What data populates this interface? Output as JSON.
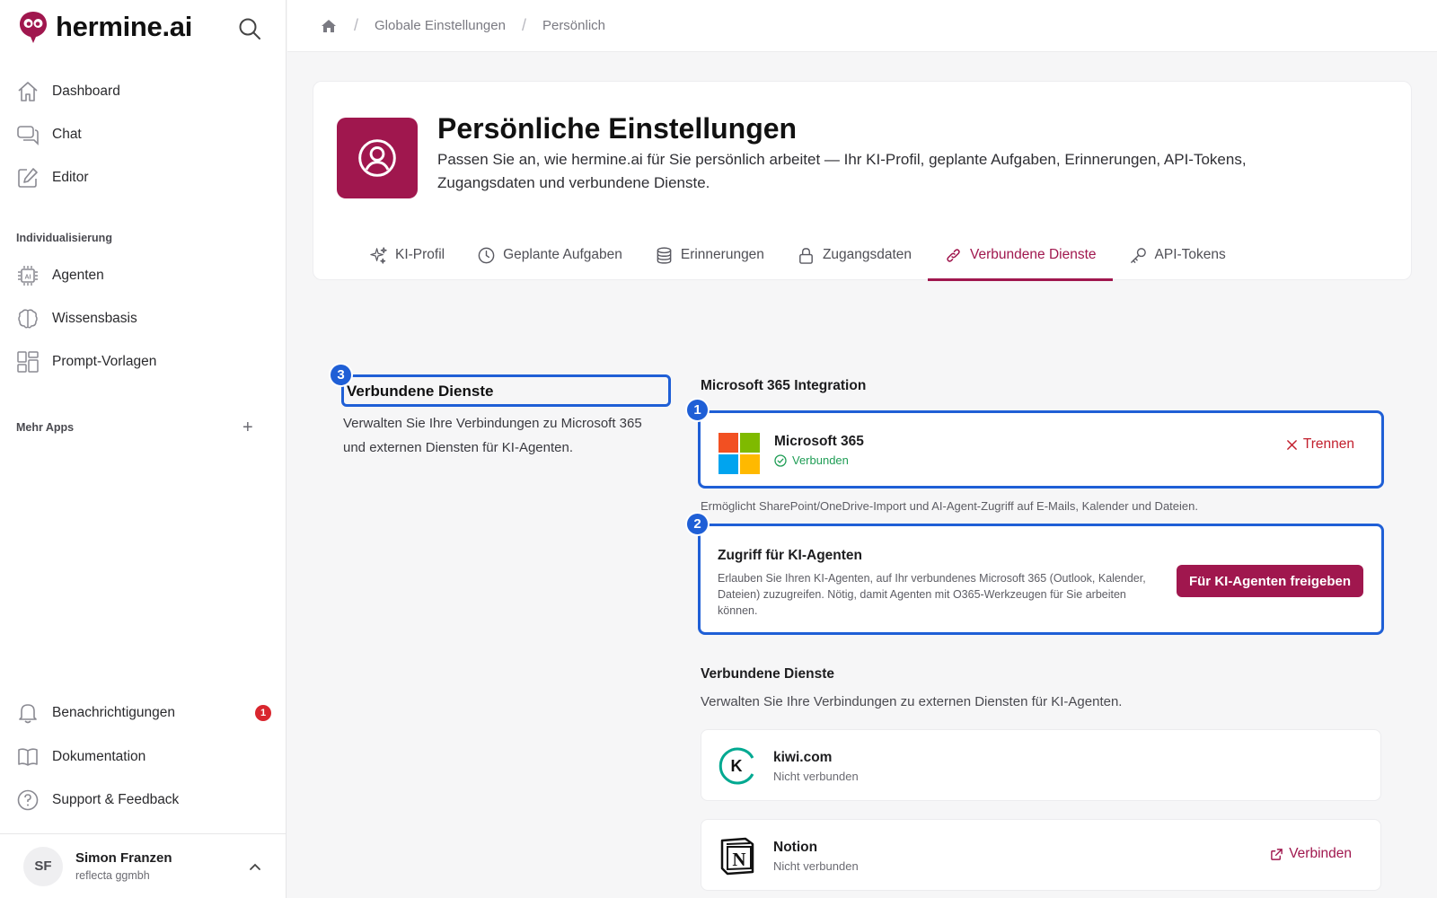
{
  "brand": {
    "name": "hermine.ai",
    "accent": "#a0174e",
    "highlight": "#1f5fd6"
  },
  "sidebar": {
    "primary": [
      {
        "label": "Dashboard",
        "icon": "home-icon"
      },
      {
        "label": "Chat",
        "icon": "chat-icon"
      },
      {
        "label": "Editor",
        "icon": "edit-icon"
      }
    ],
    "section_custom": "Individualisierung",
    "custom": [
      {
        "label": "Agenten",
        "icon": "ai-chip-icon"
      },
      {
        "label": "Wissensbasis",
        "icon": "brain-icon"
      },
      {
        "label": "Prompt-Vorlagen",
        "icon": "template-icon"
      }
    ],
    "section_apps": "Mehr Apps",
    "plus": "+",
    "bottom": [
      {
        "label": "Benachrichtigungen",
        "icon": "bell-icon",
        "badge": "1"
      },
      {
        "label": "Dokumentation",
        "icon": "book-icon"
      },
      {
        "label": "Support & Feedback",
        "icon": "help-icon"
      }
    ],
    "user": {
      "initials": "SF",
      "name": "Simon Franzen",
      "org": "reflecta ggmbh"
    }
  },
  "breadcrumb": [
    "Globale Einstellungen",
    "Persönlich"
  ],
  "header": {
    "title": "Persönliche Einstellungen",
    "subtitle": "Passen Sie an, wie hermine.ai für Sie persönlich arbeitet — Ihr KI-Profil, geplante Aufgaben, Erinnerungen, API-Tokens, Zugangsdaten und verbundene Dienste."
  },
  "tabs": [
    {
      "label": "KI-Profil",
      "icon": "sparkles-icon",
      "active": false
    },
    {
      "label": "Geplante Aufgaben",
      "icon": "clock-icon",
      "active": false
    },
    {
      "label": "Erinnerungen",
      "icon": "database-icon",
      "active": false
    },
    {
      "label": "Zugangsdaten",
      "icon": "lock-icon",
      "active": false
    },
    {
      "label": "Verbundene Dienste",
      "icon": "link-icon",
      "active": true
    },
    {
      "label": "API-Tokens",
      "icon": "key-icon",
      "active": false
    }
  ],
  "section": {
    "badge": "3",
    "title": "Verbundene Dienste",
    "description": "Verwalten Sie Ihre Verbindungen zu Microsoft 365 und externen Diensten für KI-Agenten."
  },
  "microsoft": {
    "heading": "Microsoft 365 Integration",
    "badge": "1",
    "name": "Microsoft 365",
    "status": "Verbunden",
    "disconnect": "Trennen",
    "note": "Ermöglicht SharePoint/OneDrive-Import und AI-Agent-Zugriff auf E-Mails, Kalender und Dateien."
  },
  "agent_access": {
    "badge": "2",
    "title": "Zugriff für KI-Agenten",
    "description": "Erlauben Sie Ihren KI-Agenten, auf Ihr verbundenes Microsoft 365 (Outlook, Kalender, Dateien) zuzugreifen. Nötig, damit Agenten mit O365-Werkzeugen für Sie arbeiten können.",
    "button": "Für KI-Agenten freigeben"
  },
  "services": {
    "title": "Verbundene Dienste",
    "description": "Verwalten Sie Ihre Verbindungen zu externen Diensten für KI-Agenten.",
    "items": [
      {
        "name": "kiwi.com",
        "status": "Nicht verbunden",
        "logo": "kiwi-logo"
      },
      {
        "name": "Notion",
        "status": "Nicht verbunden",
        "logo": "notion-logo",
        "action": "Verbinden"
      }
    ]
  }
}
